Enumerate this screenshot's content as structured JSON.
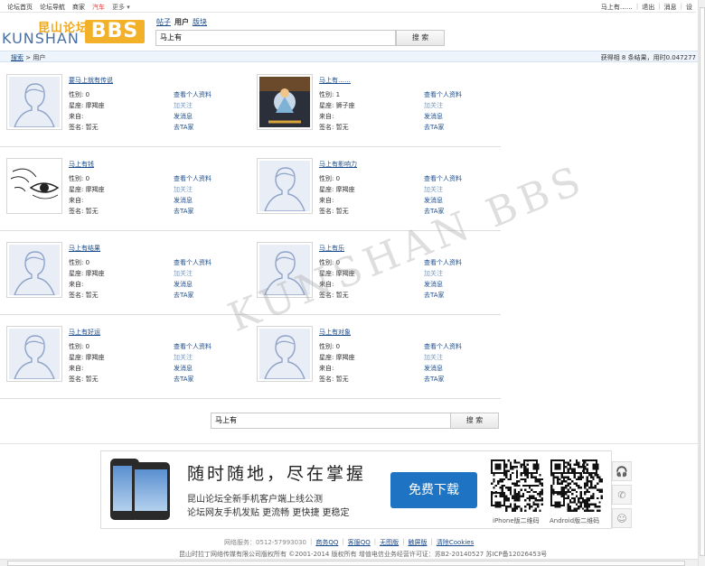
{
  "topbar": {
    "nav": [
      {
        "label": "论坛首页"
      },
      {
        "label": "论坛导航"
      },
      {
        "label": "商家"
      },
      {
        "label": "汽车"
      },
      {
        "label": "更多 ▾"
      }
    ],
    "username": "马上有……",
    "logout": "退出",
    "messages": "消息",
    "settings": "设"
  },
  "logo": {
    "cn": "昆山论坛",
    "en": "KUNSHAN",
    "bbs": "BBS"
  },
  "search": {
    "tabs": [
      {
        "label": "帖子"
      },
      {
        "label": "用户"
      },
      {
        "label": "版块"
      }
    ],
    "value": "马上有",
    "button": "搜 索"
  },
  "crumb": {
    "home": "搜索",
    "sep": " > ",
    "current": "用户",
    "info": "获得相 8 条结果，用时0.047277"
  },
  "labels": {
    "gender": "性别:",
    "zodiac": "星座:",
    "from": "来自:",
    "sign": "签名:",
    "view": "查看个人资料",
    "follow": "加关注",
    "message": "发消息",
    "visit": "去TA家"
  },
  "users": [
    {
      "name": "要马上就有传说",
      "gender": "0",
      "zodiac": "摩羯座",
      "from": "",
      "sign": "暂无",
      "avatar": "default"
    },
    {
      "name": "马上有……",
      "gender": "1",
      "zodiac": "狮子座",
      "from": "",
      "sign": "暂无",
      "avatar": "game"
    },
    {
      "name": "马上有钱",
      "gender": "0",
      "zodiac": "摩羯座",
      "from": "",
      "sign": "暂无",
      "avatar": "eye"
    },
    {
      "name": "马上有影响力",
      "gender": "0",
      "zodiac": "摩羯座",
      "from": "",
      "sign": "暂无",
      "avatar": "default"
    },
    {
      "name": "马上有结果",
      "gender": "0",
      "zodiac": "摩羯座",
      "from": "",
      "sign": "暂无",
      "avatar": "default"
    },
    {
      "name": "马上有乐",
      "gender": "0",
      "zodiac": "摩羯座",
      "from": "",
      "sign": "暂无",
      "avatar": "default"
    },
    {
      "name": "马上有好运",
      "gender": "0",
      "zodiac": "摩羯座",
      "from": "",
      "sign": "暂无",
      "avatar": "default"
    },
    {
      "name": "马上有对象",
      "gender": "0",
      "zodiac": "摩羯座",
      "from": "",
      "sign": "暂无",
      "avatar": "default"
    }
  ],
  "bottom_search": {
    "value": "马上有",
    "button": "搜 索"
  },
  "banner": {
    "slogan": "随时随地，尽在掌握",
    "line1": "昆山论坛全新手机客户端上线公测",
    "line2": "论坛网友手机发贴 更流畅 更快捷 更稳定",
    "download": "免费下载",
    "qr_iphone": "iPhone版二维码",
    "qr_android": "Android版二维码"
  },
  "footer": {
    "service": "网络服务：0512-57993030",
    "links": [
      {
        "label": "商务QQ"
      },
      {
        "label": "客服QQ"
      },
      {
        "label": "无图版"
      },
      {
        "label": "触屏版"
      },
      {
        "label": "清除Cookies"
      }
    ],
    "copyright": "昆山时拉丁网络传媒有限公司版权所有 ©2001-2014 版权所有 增值电信业务经营许可证：苏B2-20140527 苏ICP备12026453号"
  },
  "watermark": "KUNSHAN BBS"
}
